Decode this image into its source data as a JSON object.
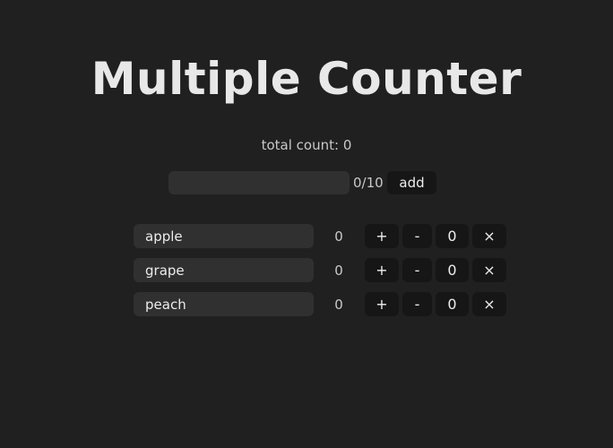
{
  "app": {
    "title": "Multiple Counter",
    "total_label": "total count: 0"
  },
  "add_form": {
    "input_value": "",
    "char_count": "0/10",
    "add_label": "add"
  },
  "items": [
    {
      "name": "apple",
      "count": "0",
      "plus_label": "+",
      "minus_label": "-",
      "reset_label": "0",
      "remove_label": "×"
    },
    {
      "name": "grape",
      "count": "0",
      "plus_label": "+",
      "minus_label": "-",
      "reset_label": "0",
      "remove_label": "×"
    },
    {
      "name": "peach",
      "count": "0",
      "plus_label": "+",
      "minus_label": "-",
      "reset_label": "0",
      "remove_label": "×"
    }
  ],
  "colors": {
    "background": "#202020",
    "input_bg": "#303030",
    "button_bg": "#161616",
    "text": "#e6e6e6"
  }
}
